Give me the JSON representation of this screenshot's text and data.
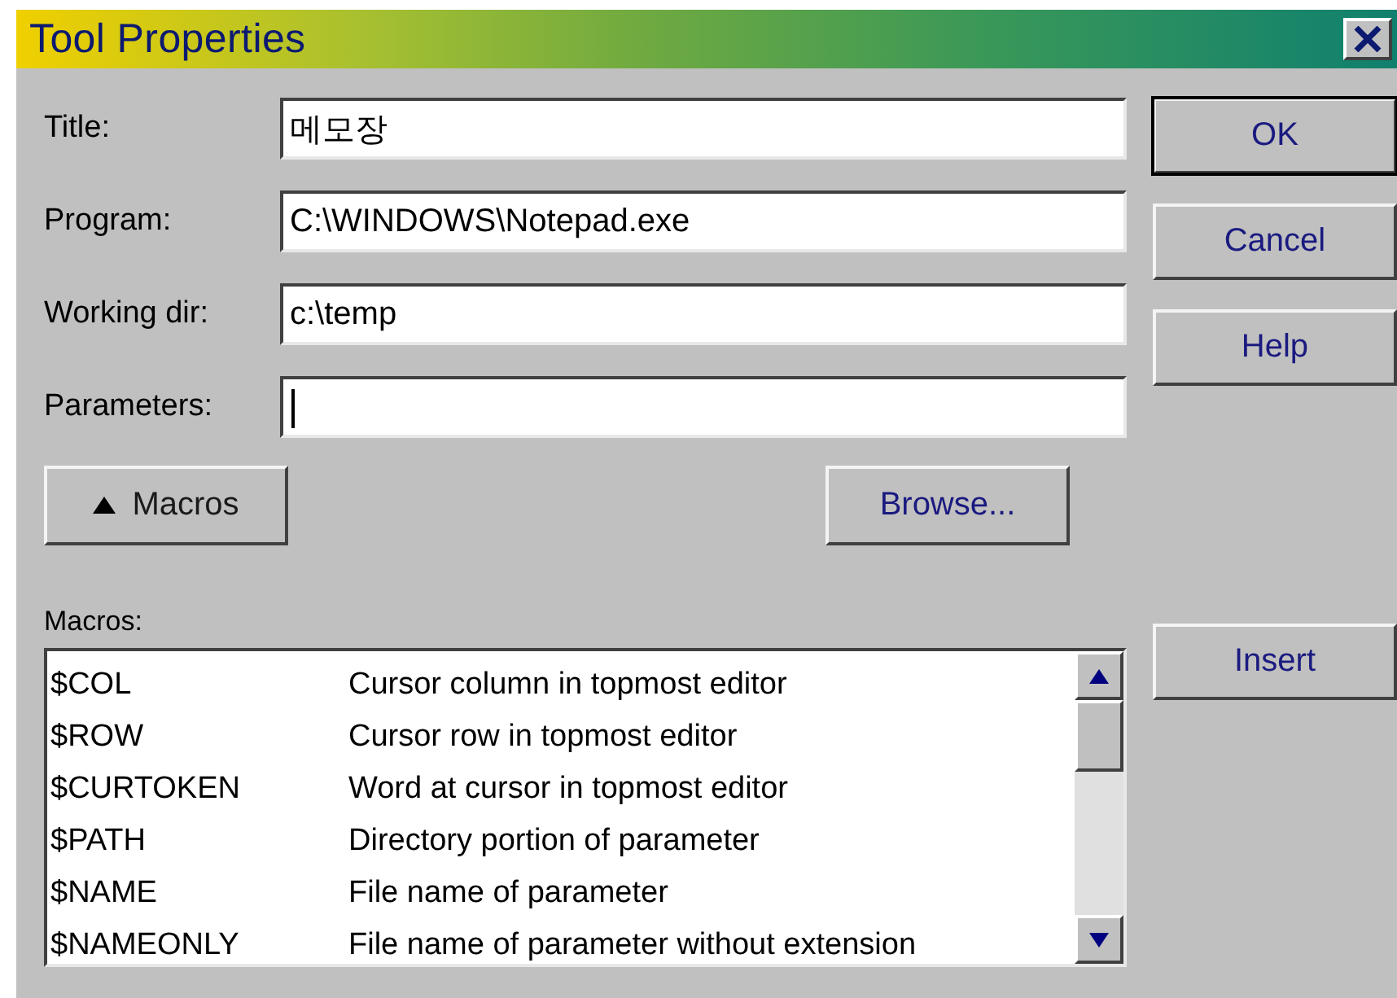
{
  "window": {
    "title": "Tool Properties"
  },
  "fields": [
    {
      "label": "Title:",
      "value": "메모장",
      "focused": false
    },
    {
      "label": "Program:",
      "value": "C:\\WINDOWS\\Notepad.exe",
      "focused": false
    },
    {
      "label": "Working dir:",
      "value": "c:\\temp",
      "focused": false
    },
    {
      "label": "Parameters:",
      "focused": true
    }
  ],
  "side_buttons": [
    {
      "label": "OK",
      "default": true
    },
    {
      "label": "Cancel",
      "default": false
    },
    {
      "label": "Help",
      "default": false
    }
  ],
  "macros_button": {
    "label": "Macros",
    "expanded": true
  },
  "browse_button": {
    "label": "Browse..."
  },
  "macros": {
    "label": "Macros:",
    "rows": [
      {
        "name": "$COL",
        "description": "Cursor column in topmost editor"
      },
      {
        "name": "$ROW",
        "description": "Cursor row in topmost editor"
      },
      {
        "name": "$CURTOKEN",
        "description": "Word at cursor in topmost editor"
      },
      {
        "name": "$PATH",
        "description": "Directory portion of parameter"
      },
      {
        "name": "$NAME",
        "description": "File name of parameter"
      },
      {
        "name": "$NAMEONLY",
        "description": "File name of parameter without extension"
      }
    ]
  },
  "insert_button": {
    "label": "Insert"
  }
}
